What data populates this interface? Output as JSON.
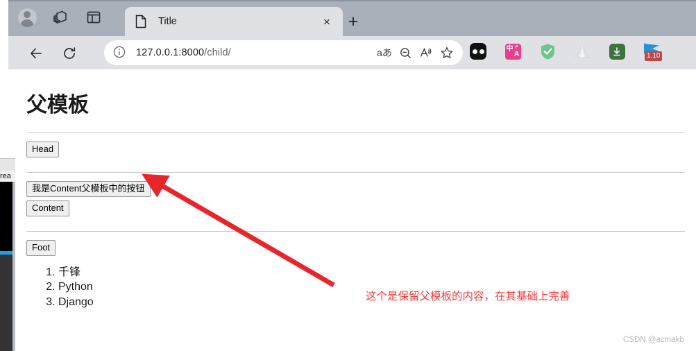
{
  "browser": {
    "toolbar_icons": [
      {
        "name": "profile-avatar-icon",
        "label": "Profile"
      },
      {
        "name": "collections-icon",
        "label": "Collections"
      },
      {
        "name": "tab-actions-icon",
        "label": "Tab actions"
      }
    ],
    "tab": {
      "title": "Title",
      "favicon": "page-icon",
      "close_label": "×"
    },
    "new_tab_label": "+",
    "nav": {
      "back_label": "←",
      "reload_label": "↻"
    },
    "address": {
      "info_icon": "info-circle-icon",
      "host": "127.0.0.1:8000",
      "path": "/child/",
      "full_url": "127.0.0.1:8000/child/",
      "actions": [
        {
          "name": "translate-icon",
          "label": "aあ"
        },
        {
          "name": "zoom-out-icon",
          "label": "⊖"
        },
        {
          "name": "read-aloud-icon",
          "label": "A"
        },
        {
          "name": "favorite-star-icon",
          "label": "☆"
        }
      ]
    },
    "extensions": [
      {
        "name": "dots-extension-icon",
        "label": ""
      },
      {
        "name": "translate-extension-icon",
        "cn": "中",
        "en": "A",
        "arrow": "↱"
      },
      {
        "name": "adguard-shield-icon",
        "label": "✓"
      },
      {
        "name": "tent-extension-icon",
        "label": ""
      },
      {
        "name": "download-extension-icon",
        "label": "⬇"
      },
      {
        "name": "flag-extension-icon",
        "badge": "1.10"
      }
    ]
  },
  "page": {
    "heading": "父模板",
    "buttons": {
      "head": "Head",
      "content_parent": "我是Content父模板中的按钮",
      "content": "Content",
      "foot": "Foot"
    },
    "list": [
      "千锋",
      "Python",
      "Django"
    ]
  },
  "annotation": {
    "text": "这个是保留父模板的内容，在其基础上完善",
    "color": "#ef3b3b"
  },
  "watermark": "CSDN @acmakb",
  "background_windows": {
    "text_fragment": "rea"
  }
}
